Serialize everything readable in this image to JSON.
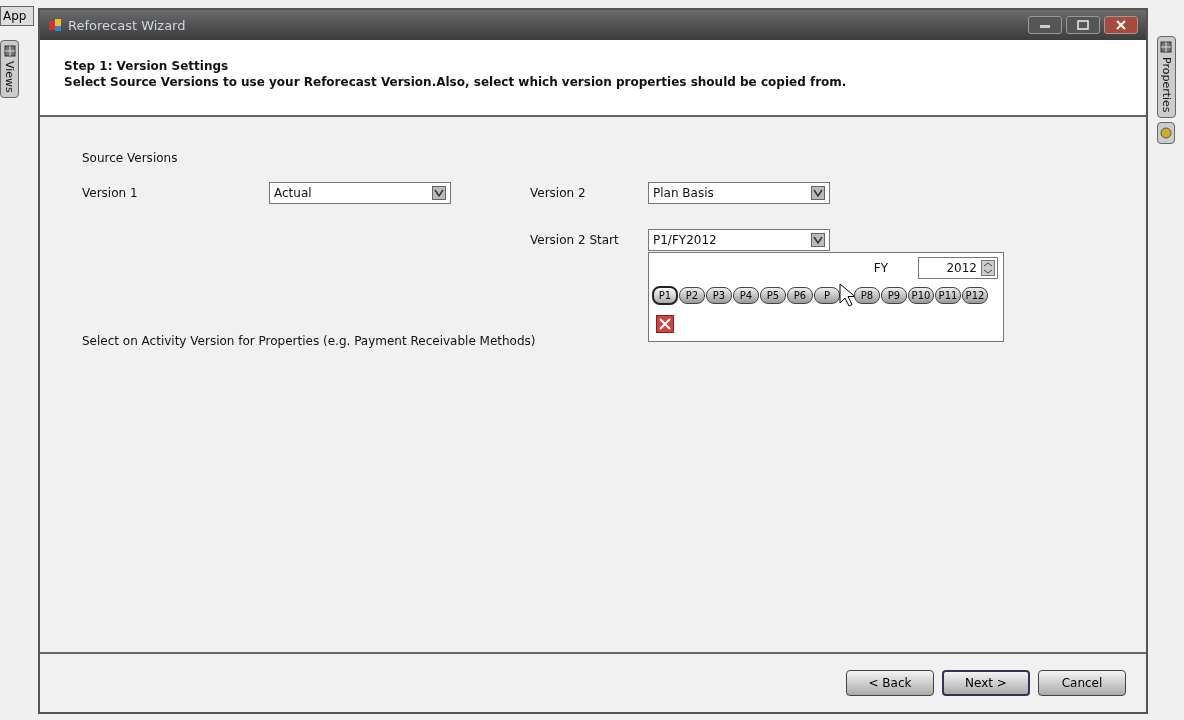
{
  "background_app": {
    "app_button": "App",
    "left_tab": "Views",
    "right_tab": "Properties"
  },
  "window": {
    "title": "Reforecast Wizard"
  },
  "header": {
    "step": "Step 1: Version Settings",
    "instruction": "Select Source Versions to use your Reforecast Version.Also, select which version properties should be copied from."
  },
  "source_versions": {
    "heading": "Source Versions",
    "version_1": {
      "label": "Version 1",
      "value": "Actual"
    },
    "version_2": {
      "label": "Version 2",
      "value": "Plan Basis"
    },
    "version_2_start": {
      "label": "Version 2 Start",
      "value": "P1/FY2012"
    }
  },
  "activity_label": "Select on Activity Version for Properties (e.g. Payment  Receivable Methods)",
  "period_popup": {
    "fy_label": "FY",
    "fy_value": "2012",
    "periods": [
      {
        "label": "P1",
        "selected": true
      },
      {
        "label": "P2",
        "selected": false
      },
      {
        "label": "P3",
        "selected": false
      },
      {
        "label": "P4",
        "selected": false
      },
      {
        "label": "P5",
        "selected": false
      },
      {
        "label": "P6",
        "selected": false
      },
      {
        "label": "P",
        "selected": false
      },
      {
        "label": "P8",
        "selected": false
      },
      {
        "label": "P9",
        "selected": false
      },
      {
        "label": "P10",
        "selected": false
      },
      {
        "label": "P11",
        "selected": false
      },
      {
        "label": "P12",
        "selected": false
      }
    ]
  },
  "buttons": [
    {
      "label": "< Back",
      "selected": false
    },
    {
      "label": "Next >",
      "selected": true
    },
    {
      "label": "Cancel",
      "selected": false
    }
  ]
}
